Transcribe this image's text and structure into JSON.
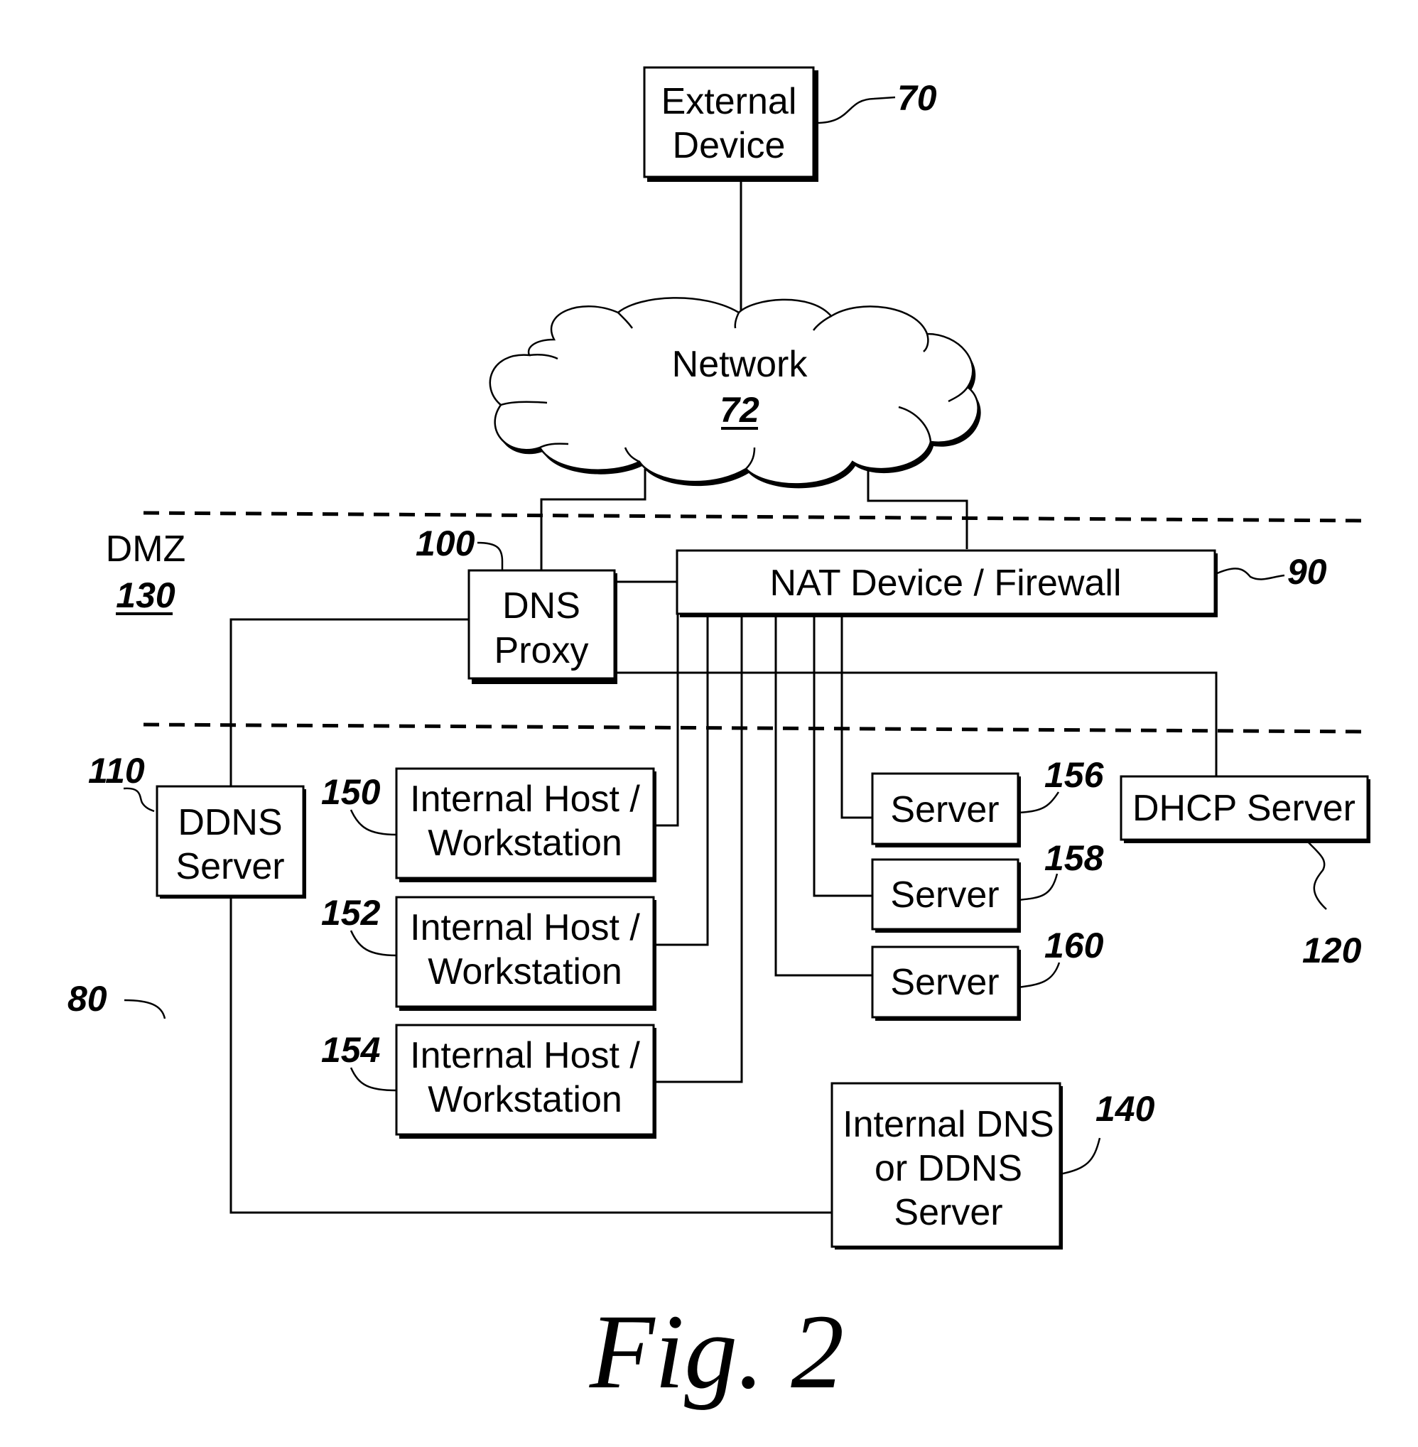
{
  "figure": {
    "caption": "Fig. 2",
    "system_ref": "80"
  },
  "zones": {
    "dmz_label": "DMZ",
    "dmz_ref": "130"
  },
  "nodes": {
    "external_device": {
      "line1": "External",
      "line2": "Device",
      "ref": "70"
    },
    "network": {
      "label": "Network",
      "ref": "72"
    },
    "dns_proxy": {
      "line1": "DNS",
      "line2": "Proxy",
      "ref": "100"
    },
    "nat_firewall": {
      "label": "NAT Device / Firewall",
      "ref": "90"
    },
    "ddns_server": {
      "line1": "DDNS",
      "line2": "Server",
      "ref": "110"
    },
    "dhcp_server": {
      "label": "DHCP Server",
      "ref": "120"
    },
    "host_150": {
      "line1": "Internal Host /",
      "line2": "Workstation",
      "ref": "150"
    },
    "host_152": {
      "line1": "Internal Host /",
      "line2": "Workstation",
      "ref": "152"
    },
    "host_154": {
      "line1": "Internal Host /",
      "line2": "Workstation",
      "ref": "154"
    },
    "server_156": {
      "label": "Server",
      "ref": "156"
    },
    "server_158": {
      "label": "Server",
      "ref": "158"
    },
    "server_160": {
      "label": "Server",
      "ref": "160"
    },
    "internal_dns": {
      "line1": "Internal DNS",
      "line2": "or DDNS",
      "line3": "Server",
      "ref": "140"
    }
  }
}
